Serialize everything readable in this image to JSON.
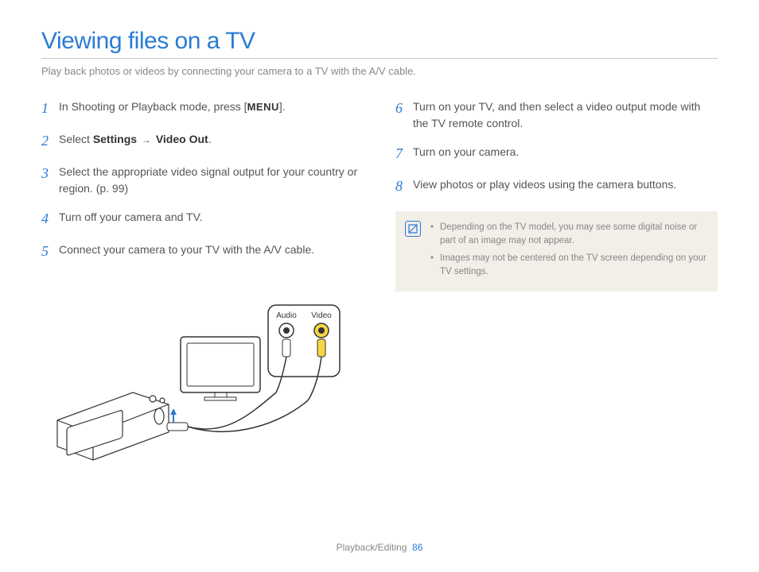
{
  "title": "Viewing files on a TV",
  "intro": "Play back photos or videos by connecting your camera to a TV with the A/V cable.",
  "left_steps": [
    {
      "num": "1",
      "pre": "In Shooting or Playback mode, press [",
      "menu": "MENU",
      "post": "]."
    },
    {
      "num": "2",
      "pre": "Select ",
      "b1": "Settings",
      "arrow": "→",
      "b2": "Video Out",
      "post": "."
    },
    {
      "num": "3",
      "text": "Select the appropriate video signal output for your country or region. (p. 99)"
    },
    {
      "num": "4",
      "text": "Turn off your camera and TV."
    },
    {
      "num": "5",
      "text": "Connect your camera to your TV with the A/V cable."
    }
  ],
  "right_steps": [
    {
      "num": "6",
      "text": "Turn on your TV, and then select a video output mode with the TV remote control."
    },
    {
      "num": "7",
      "text": "Turn on your camera."
    },
    {
      "num": "8",
      "text": "View photos or play videos using the camera buttons."
    }
  ],
  "notes": [
    "Depending on the TV model, you may see some digital noise or part of an image may not appear.",
    "Images may not be centered on the TV screen depending on your TV settings."
  ],
  "diagram": {
    "audio": "Audio",
    "video": "Video"
  },
  "footer": {
    "section": "Playback/Editing",
    "page": "86"
  }
}
